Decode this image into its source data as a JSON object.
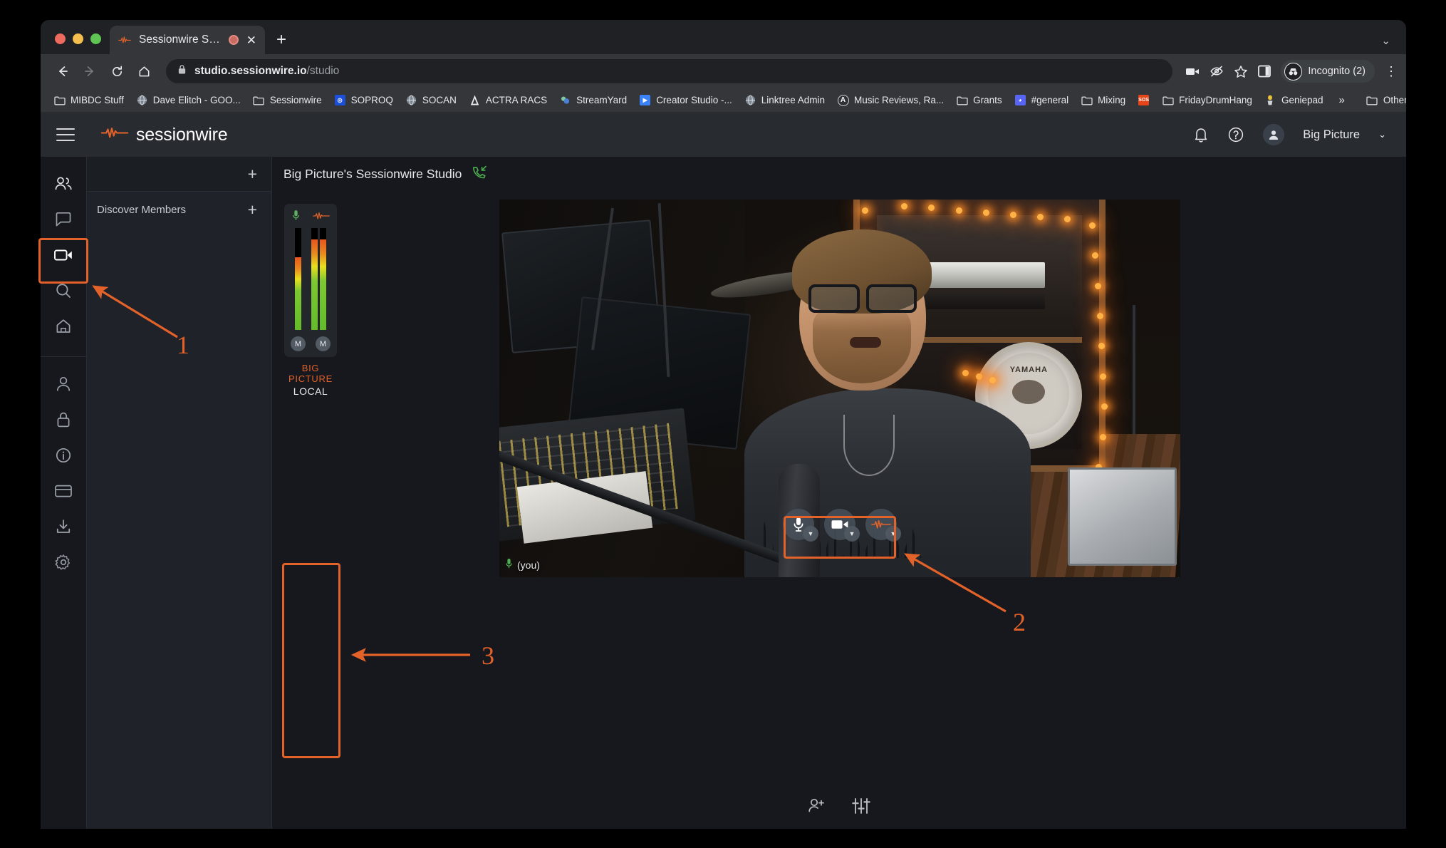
{
  "browser": {
    "tab": {
      "title": "Sessionwire Studio",
      "favicon_icon": "sessionwire-waveform-icon",
      "recording_icon": "recording-indicator-icon",
      "close_icon": "close-icon"
    },
    "new_tab_icon": "new-tab-plus-icon",
    "window_controls": [
      "close",
      "minimize",
      "maximize"
    ],
    "window_caret_icon": "chevron-down-icon",
    "nav": {
      "back_icon": "back-arrow-icon",
      "forward_icon": "forward-arrow-icon",
      "reload_icon": "reload-icon",
      "home_icon": "home-icon"
    },
    "omnibox": {
      "lock_icon": "lock-icon",
      "host": "studio.sessionwire.io",
      "path": "/studio"
    },
    "toolbar_right": {
      "cast_icon": "camera-video-icon",
      "eye_off_icon": "eye-off-icon",
      "bookmark_star_icon": "star-icon",
      "side_panel_icon": "side-panel-icon",
      "profile_label": "Incognito (2)",
      "profile_icon": "incognito-icon",
      "menu_icon": "kebab-menu-icon"
    },
    "bookmarks": [
      {
        "label": "MIBDC Stuff",
        "icon": "folder-icon"
      },
      {
        "label": "Dave Elitch - GOO...",
        "icon": "globe-icon"
      },
      {
        "label": "Sessionwire",
        "icon": "folder-icon"
      },
      {
        "label": "SOPROQ",
        "icon": "soproq-icon",
        "color": "#1b4fd8"
      },
      {
        "label": "SOCAN",
        "icon": "globe-icon"
      },
      {
        "label": "ACTRA RACS",
        "icon": "actra-icon"
      },
      {
        "label": "StreamYard",
        "icon": "streamyard-icon"
      },
      {
        "label": "Creator Studio -...",
        "icon": "creator-studio-icon",
        "color": "#3b82f6"
      },
      {
        "label": "Linktree Admin",
        "icon": "globe-icon"
      },
      {
        "label": "Music Reviews, Ra...",
        "icon": "allmusic-icon"
      },
      {
        "label": "Grants",
        "icon": "folder-icon"
      },
      {
        "label": "#general",
        "icon": "discord-icon",
        "color": "#5865f2"
      },
      {
        "label": "Mixing",
        "icon": "folder-icon"
      },
      {
        "label": "SOS",
        "icon": "sos-icon",
        "color": "#e8441a"
      },
      {
        "label": "FridayDrumHang",
        "icon": "folder-icon"
      },
      {
        "label": "Geniepad",
        "icon": "geniepad-icon"
      }
    ],
    "bookmarks_overflow_icon": "chevron-double-right-icon",
    "other_bookmarks": {
      "label": "Other Bookmarks",
      "icon": "folder-icon"
    }
  },
  "app": {
    "header": {
      "menu_icon": "hamburger-menu-icon",
      "brand": "sessionwire",
      "brand_logo_icon": "sessionwire-waveform-icon",
      "notifications_icon": "bell-icon",
      "help_icon": "help-circle-icon",
      "avatar_icon": "avatar-icon",
      "user_name": "Big Picture",
      "user_caret_icon": "chevron-down-icon"
    },
    "rail": [
      {
        "name": "people",
        "icon": "people-icon",
        "active": false
      },
      {
        "name": "chat",
        "icon": "chat-bubble-icon",
        "active": false
      },
      {
        "name": "video",
        "icon": "video-camera-icon",
        "active": true
      },
      {
        "name": "search",
        "icon": "search-icon",
        "active": false
      },
      {
        "name": "home",
        "icon": "home-icon",
        "active": false
      },
      {
        "name": "profile",
        "icon": "person-icon",
        "active": false
      },
      {
        "name": "security",
        "icon": "lock-icon",
        "active": false
      },
      {
        "name": "info",
        "icon": "info-circle-icon",
        "active": false
      },
      {
        "name": "billing",
        "icon": "credit-card-icon",
        "active": false
      },
      {
        "name": "downloads",
        "icon": "download-icon",
        "active": false
      },
      {
        "name": "settings",
        "icon": "gear-icon",
        "active": false
      }
    ],
    "members_panel": {
      "add_icon": "plus-icon",
      "discover_label": "Discover Members",
      "discover_add_icon": "plus-icon"
    },
    "stage": {
      "title": "Big Picture's Sessionwire Studio",
      "call_icon": "phone-incoming-icon",
      "video": {
        "you_label": "(you)",
        "you_mic_icon": "mic-icon"
      },
      "media_controls": [
        {
          "name": "microphone",
          "icon": "mic-icon",
          "caret_icon": "chevron-down-icon"
        },
        {
          "name": "camera",
          "icon": "video-camera-icon",
          "caret_icon": "chevron-down-icon"
        },
        {
          "name": "sessionwire-audio",
          "icon": "sessionwire-waveform-icon",
          "caret_icon": "chevron-down-icon"
        }
      ],
      "meter": {
        "mic_icon": "mic-icon",
        "wire_icon": "sessionwire-waveform-icon",
        "mute_label": "M",
        "channels": [
          {
            "name": "mic",
            "level": 71,
            "peak": 71
          },
          {
            "name": "wire-left",
            "level": 89,
            "peak": 100
          },
          {
            "name": "wire-right",
            "level": 89,
            "peak": 100
          }
        ],
        "name_label": "BIG PICTURE",
        "sub_label": "LOCAL"
      },
      "bottom_bar": [
        {
          "name": "invite-user",
          "icon": "add-person-icon"
        },
        {
          "name": "mixer",
          "icon": "sliders-icon"
        }
      ]
    }
  },
  "annotations": {
    "accent_color": "#e2622a",
    "items": [
      {
        "number": "1",
        "target": "video-rail-icon"
      },
      {
        "number": "2",
        "target": "media-controls-cluster"
      },
      {
        "number": "3",
        "target": "audio-meter-strip"
      }
    ]
  }
}
